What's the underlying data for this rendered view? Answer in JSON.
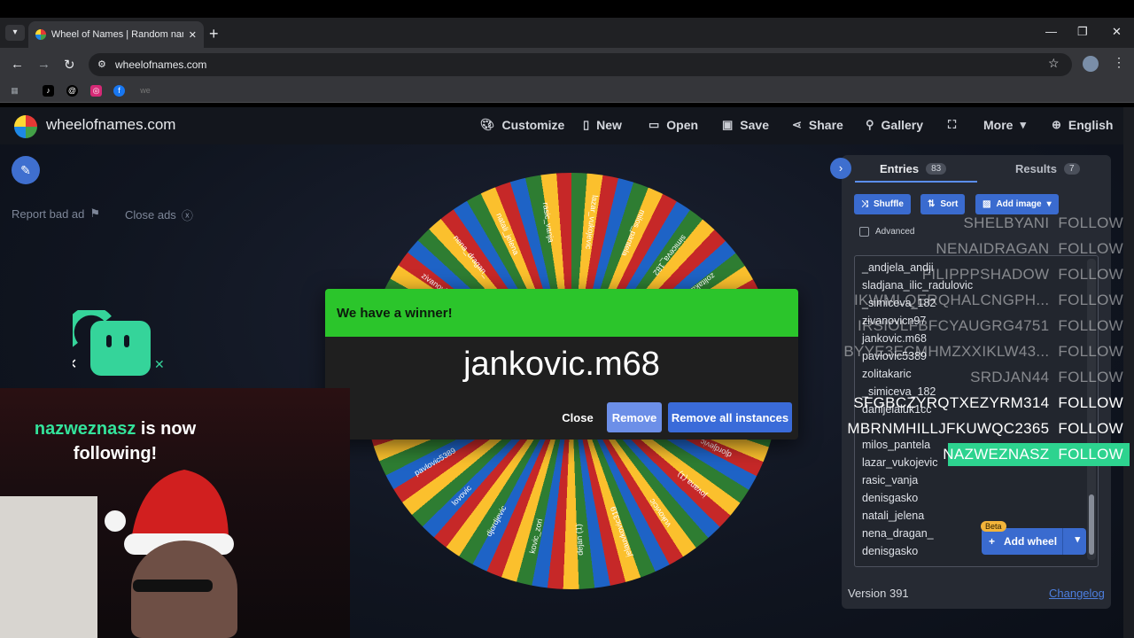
{
  "browser": {
    "tab_title": "Wheel of Names | Random name",
    "url": "wheelofnames.com",
    "bookmarks": [
      "TikTok",
      "Threads",
      "Instagram",
      "Facebook",
      "we"
    ]
  },
  "app": {
    "logo_text": "wheelofnames.com",
    "nav": {
      "customize": "Customize",
      "new": "New",
      "open": "Open",
      "save": "Save",
      "share": "Share",
      "gallery": "Gallery",
      "more": "More",
      "language": "English"
    },
    "report_ad": "Report bad ad",
    "close_ads": "Close ads"
  },
  "dialog": {
    "header": "We have a winner!",
    "winner": "jankovic.m68",
    "close": "Close",
    "remove": "Remove",
    "remove_all": "Remove all instances"
  },
  "panel": {
    "entries_label": "Entries",
    "entries_count": "83",
    "results_label": "Results",
    "results_count": "7",
    "shuffle": "Shuffle",
    "sort": "Sort",
    "add_image": "Add image",
    "advanced": "Advanced",
    "entries": [
      "_andjela_andji",
      "sladjana_ilic_radulovic",
      "_simiceva_182",
      "zivanovicn97",
      "jankovic.m68",
      "pavlovic5389",
      "zolitakaric",
      "_simiceva_182",
      "danijelaluk1cc",
      "",
      "milos_pantela",
      "lazar_vukojevic",
      "rasic_vanja",
      "denisgasko",
      "natali_jelena",
      "nena_dragan_",
      "denisgasko"
    ],
    "add_wheel": "Add wheel",
    "beta": "Beta",
    "version": "Version 391",
    "changelog": "Changelog"
  },
  "wheel_labels": [
    "vasic1989",
    "zivanovicn97",
    "nena_dragan_",
    "natali_jelena",
    "rasic_vanja",
    "lazar_vukojevic",
    "milos_pantela",
    "simiceva_182",
    "zolitakaric",
    "jankovic.m68",
    "gronitismo",
    "xavili (17)",
    "djordjevic",
    "jovana (1)",
    "vukovicic",
    "jelauvkovic319",
    "dejan (1)",
    "kovic_zori",
    "djordjevic",
    "lovovic",
    "pavlovic5389",
    "dynaksosic"
  ],
  "overlay": {
    "follow_name": "nazweznasz",
    "follow_text": " is now following!",
    "ticker": [
      {
        "name": "SHELBYANI",
        "tag": "FOLLOW"
      },
      {
        "name": "NENAIDRAGAN",
        "tag": "FOLLOW"
      },
      {
        "name": "FILIPPPSHADOW",
        "tag": "FOLLOW"
      },
      {
        "name": "IKWMLQERQHALCNGPH...",
        "tag": "FOLLOW"
      },
      {
        "name": "IRSIOLFBFCYAUGRG4751",
        "tag": "FOLLOW"
      },
      {
        "name": "BYYE3ECMHMZXXIKLW43...",
        "tag": "FOLLOW"
      },
      {
        "name": "SRDJAN44",
        "tag": "FOLLOW"
      },
      {
        "name": "SFGBCZYRQTXEZYRM314",
        "tag": "FOLLOW"
      },
      {
        "name": "MBRNMHILLJFKUWQC2365",
        "tag": "FOLLOW"
      },
      {
        "name": "NAZWEZNASZ",
        "tag": "FOLLOW"
      }
    ]
  }
}
